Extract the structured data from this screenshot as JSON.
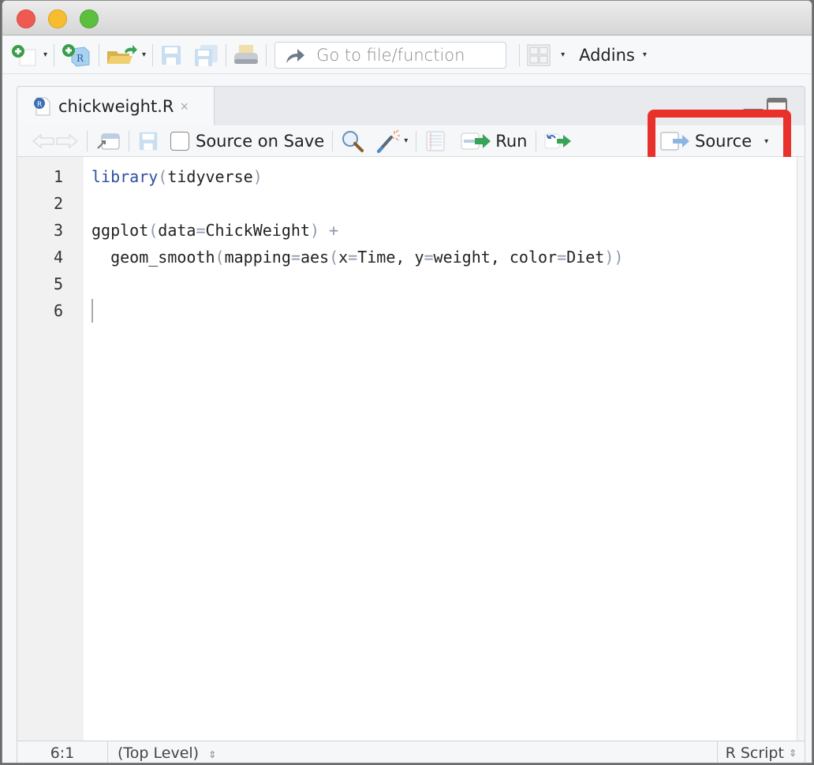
{
  "window": {
    "traffic_lights": [
      "close",
      "minimize",
      "zoom"
    ]
  },
  "main_toolbar": {
    "new_file_icon": "plus-circle-icon",
    "new_project_icon": "new-project-icon",
    "open_file_icon": "folder-open-icon",
    "save_icon": "save-icon",
    "save_all_icon": "save-all-icon",
    "print_icon": "print-icon",
    "goto_placeholder": "Go to file/function",
    "layout_icon": "grid-layout-icon",
    "addins_label": "Addins",
    "caret": "▾"
  },
  "editor": {
    "tab": {
      "filename": "chickweight.R",
      "close": "×"
    },
    "toolbar": {
      "source_on_save_label": "Source on Save",
      "source_on_save_checked": false,
      "run_label": "Run",
      "source_label": "Source",
      "caret": "▾"
    },
    "highlight_color": "#e8312a",
    "lines": [
      {
        "number": "1",
        "tokens": [
          {
            "t": "library",
            "c": "kw"
          },
          {
            "t": "(",
            "c": "pn"
          },
          {
            "t": "tidyverse",
            "c": ""
          },
          {
            "t": ")",
            "c": "pn"
          }
        ]
      },
      {
        "number": "2",
        "tokens": []
      },
      {
        "number": "3",
        "tokens": [
          {
            "t": "ggplot",
            "c": ""
          },
          {
            "t": "(",
            "c": "pn"
          },
          {
            "t": "data",
            "c": ""
          },
          {
            "t": "=",
            "c": "pn"
          },
          {
            "t": "ChickWeight",
            "c": ""
          },
          {
            "t": ")",
            "c": "pn"
          },
          {
            "t": " +",
            "c": "pn"
          }
        ]
      },
      {
        "number": "4",
        "tokens": [
          {
            "t": "  geom_smooth",
            "c": ""
          },
          {
            "t": "(",
            "c": "pn"
          },
          {
            "t": "mapping",
            "c": ""
          },
          {
            "t": "=",
            "c": "pn"
          },
          {
            "t": "aes",
            "c": ""
          },
          {
            "t": "(",
            "c": "pn"
          },
          {
            "t": "x",
            "c": ""
          },
          {
            "t": "=",
            "c": "pn"
          },
          {
            "t": "Time, y",
            "c": ""
          },
          {
            "t": "=",
            "c": "pn"
          },
          {
            "t": "weight, color",
            "c": ""
          },
          {
            "t": "=",
            "c": "pn"
          },
          {
            "t": "Diet",
            "c": ""
          },
          {
            "t": "))",
            "c": "pn"
          }
        ]
      },
      {
        "number": "5",
        "tokens": []
      },
      {
        "number": "6",
        "tokens": []
      }
    ],
    "cursor_line": 6
  },
  "statusbar": {
    "position": "6:1",
    "scope": "(Top Level)",
    "file_type": "R Script",
    "updown": "⇕"
  }
}
